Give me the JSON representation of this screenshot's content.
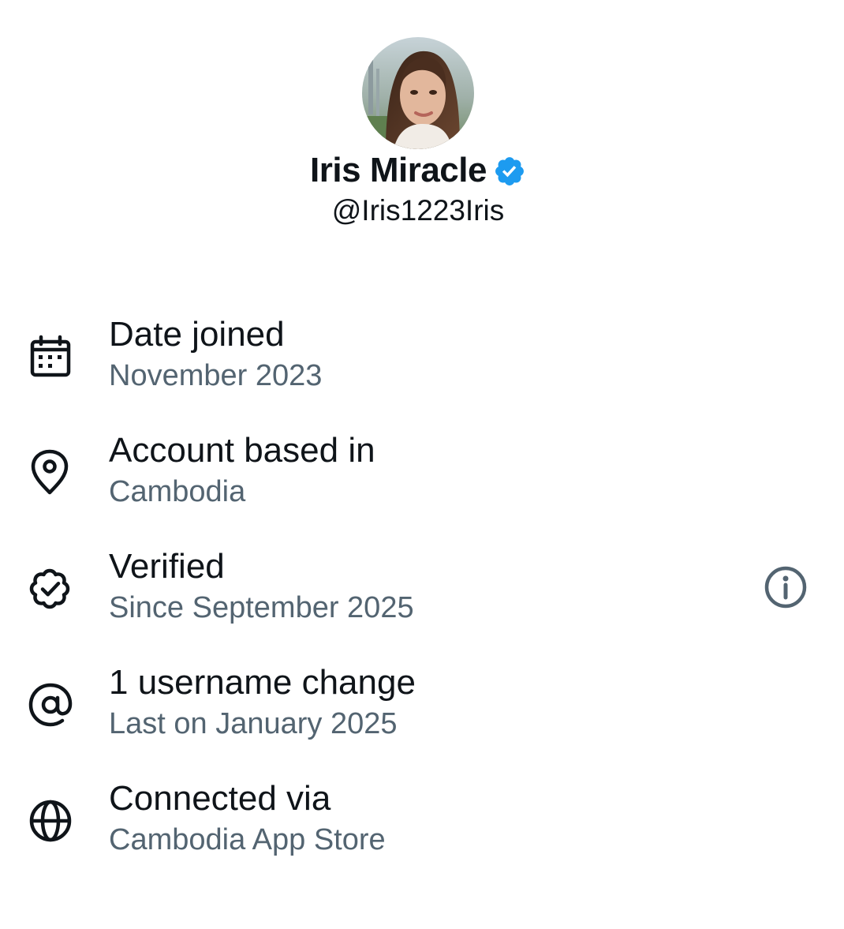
{
  "profile": {
    "display_name": "Iris Miracle",
    "handle": "@Iris1223Iris",
    "verified": true,
    "badge_color": "#1d9bf0",
    "avatar_icon": "profile-photo"
  },
  "about": {
    "items": [
      {
        "icon": "calendar-icon",
        "title": "Date joined",
        "subtitle": "November 2023"
      },
      {
        "icon": "location-pin-icon",
        "title": "Account based in",
        "subtitle": "Cambodia"
      },
      {
        "icon": "verified-badge-icon",
        "title": "Verified",
        "subtitle": "Since September 2025",
        "has_info_button": true
      },
      {
        "icon": "at-sign-icon",
        "title": "1 username change",
        "subtitle": "Last on January 2025"
      },
      {
        "icon": "globe-icon",
        "title": "Connected via",
        "subtitle": "Cambodia App Store"
      }
    ]
  },
  "colors": {
    "primary_text": "#0f1419",
    "secondary_text": "#536471",
    "icon": "#0f1419",
    "info_icon": "#536471"
  }
}
